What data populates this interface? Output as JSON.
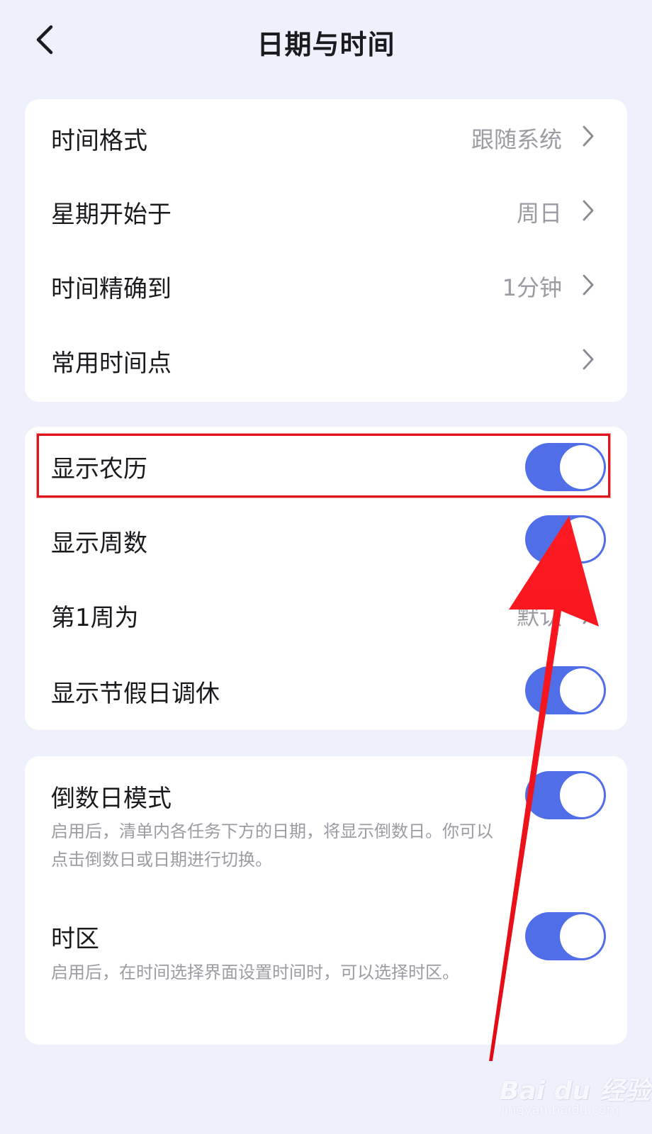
{
  "header": {
    "back_icon": "chevron-left-icon",
    "title": "日期与时间"
  },
  "section1": {
    "rows": [
      {
        "label": "时间格式",
        "value": "跟随系统"
      },
      {
        "label": "星期开始于",
        "value": "周日"
      },
      {
        "label": "时间精确到",
        "value": "1分钟"
      },
      {
        "label": "常用时间点",
        "value": ""
      }
    ]
  },
  "section2": {
    "rows": [
      {
        "label": "显示农历",
        "toggle": true
      },
      {
        "label": "显示周数",
        "toggle": true
      },
      {
        "label": "第1周为",
        "value": "默认"
      },
      {
        "label": "显示节假日调休",
        "toggle": true
      }
    ]
  },
  "section3": {
    "rows": [
      {
        "label": "倒数日模式",
        "toggle": true,
        "description": "启用后，清单内各任务下方的日期，将显示倒数日。你可以点击倒数日或日期进行切换。"
      },
      {
        "label": "时区",
        "toggle": true,
        "description": "启用后，在时间选择界面设置时间时，可以选择时区。"
      }
    ]
  },
  "annotation": {
    "highlight_color": "#e0141c",
    "arrow_color": "#f0121b"
  },
  "colors": {
    "toggle_on": "#4f6ee8",
    "background": "#eef1fb"
  },
  "watermark": {
    "text": "Bai du 经验",
    "subtext": "jingyan.baidu.com"
  }
}
